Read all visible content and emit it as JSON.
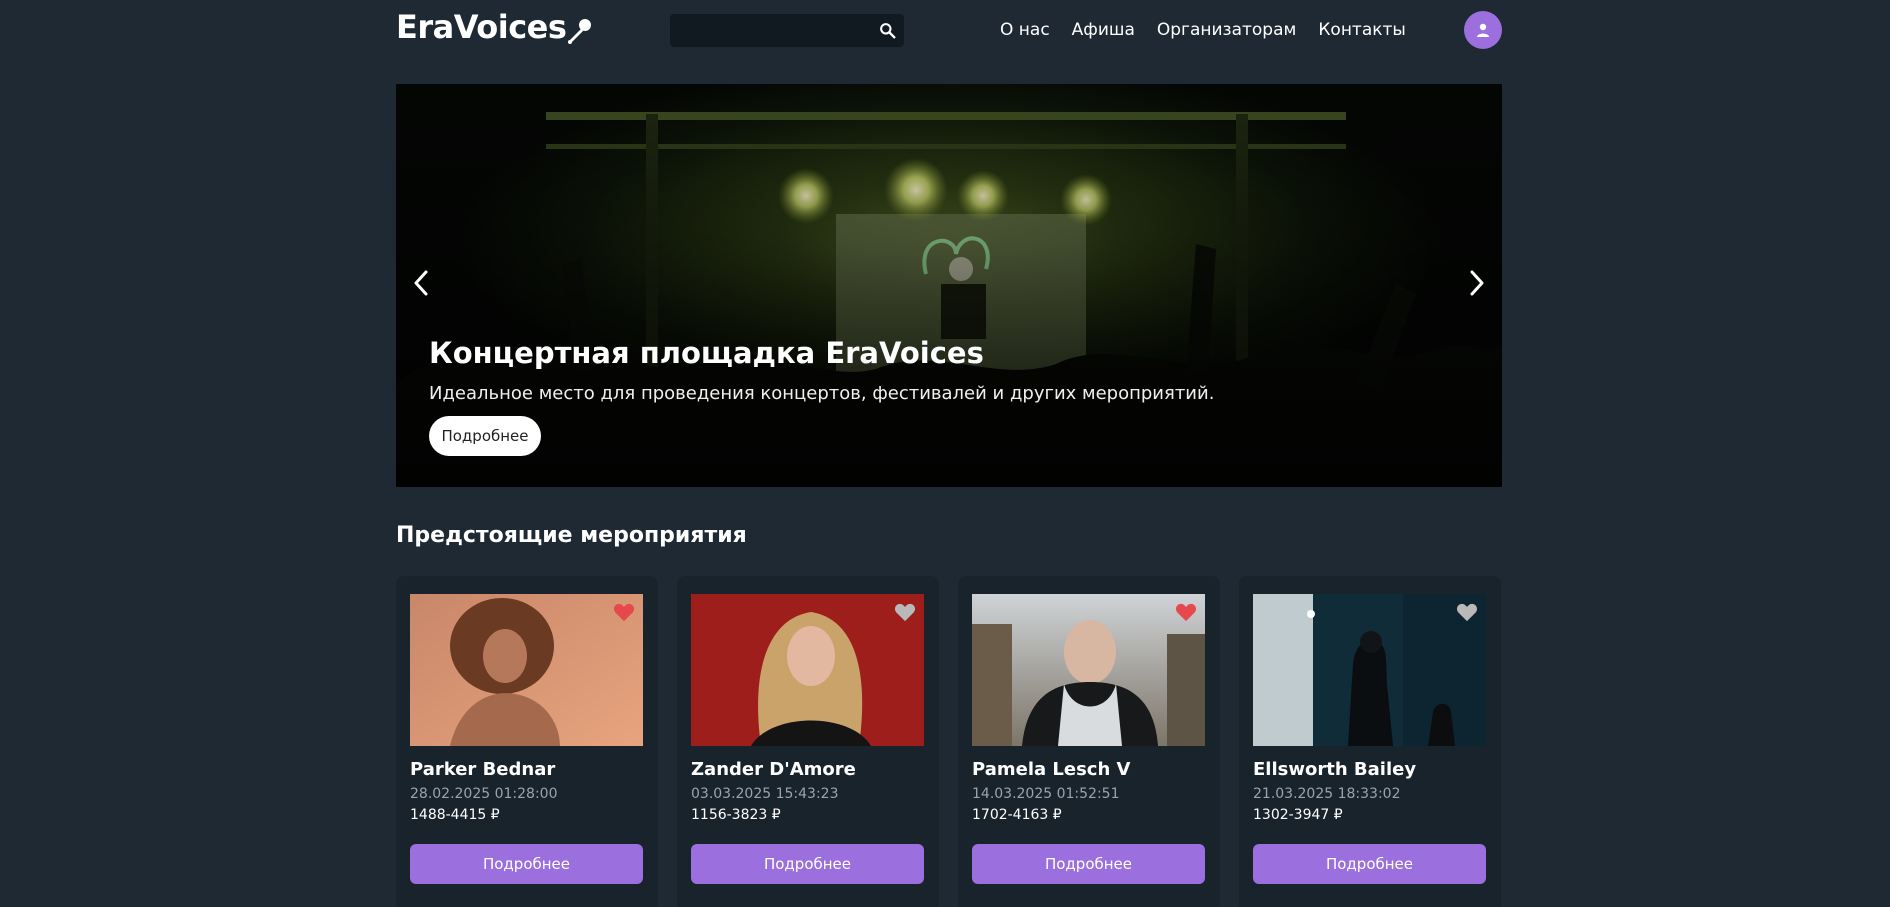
{
  "header": {
    "logo_text": "EraVoices",
    "search": {
      "value": "",
      "placeholder": ""
    },
    "nav": [
      {
        "label": "О нас"
      },
      {
        "label": "Афиша"
      },
      {
        "label": "Организаторам"
      },
      {
        "label": "Контакты"
      }
    ]
  },
  "hero": {
    "title": "Концертная площадка EraVoices",
    "subtitle": "Идеальное место для проведения концертов, фестивалей и других мероприятий.",
    "button_label": "Подробнее"
  },
  "events": {
    "title": "Предстоящие мероприятия",
    "items": [
      {
        "name": "Parker Bednar",
        "date": "28.02.2025 01:28:00",
        "price": "1488-4415 ₽",
        "liked": true,
        "button_label": "Подробнее"
      },
      {
        "name": "Zander D'Amore",
        "date": "03.03.2025 15:43:23",
        "price": "1156-3823 ₽",
        "liked": false,
        "button_label": "Подробнее"
      },
      {
        "name": "Pamela Lesch V",
        "date": "14.03.2025 01:52:51",
        "price": "1702-4163 ₽",
        "liked": true,
        "button_label": "Подробнее"
      },
      {
        "name": "Ellsworth Bailey",
        "date": "21.03.2025 18:33:02",
        "price": "1302-3947 ₽",
        "liked": false,
        "button_label": "Подробнее"
      }
    ]
  },
  "colors": {
    "background": "#1f2933",
    "card": "#19232c",
    "accent": "#9b6fde",
    "heart_active": "#e5484d",
    "heart_inactive": "#b9b9b9"
  },
  "icons": {
    "logo": "microphone-icon",
    "search": "search-icon",
    "avatar": "user-icon",
    "prev": "chevron-left-icon",
    "next": "chevron-right-icon",
    "favorite": "heart-icon"
  }
}
